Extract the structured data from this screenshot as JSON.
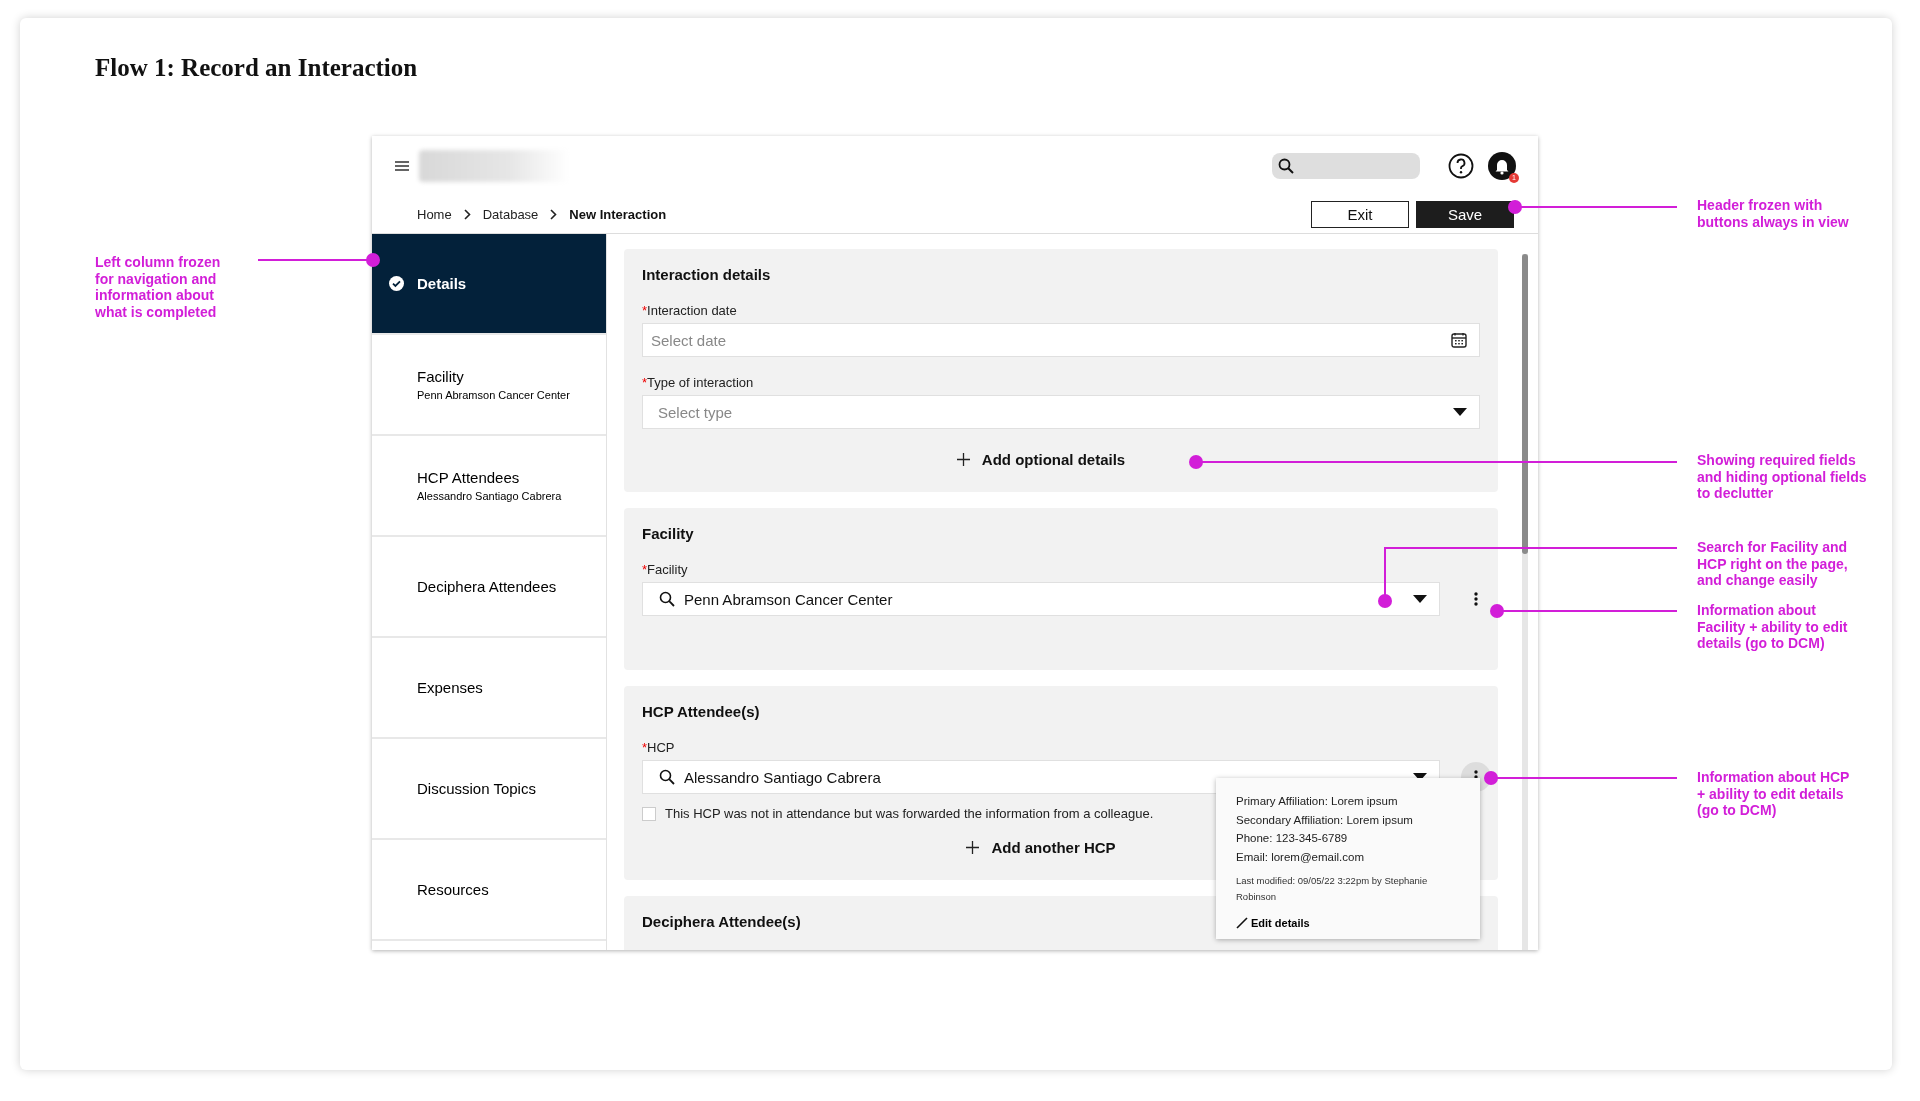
{
  "title": "Flow 1: Record an Interaction",
  "header": {
    "notification_count": "1",
    "breadcrumbs": [
      {
        "label": "Home",
        "current": false
      },
      {
        "label": "Database",
        "current": false
      },
      {
        "label": "New Interaction",
        "current": true
      }
    ],
    "buttons": [
      {
        "label": "Exit",
        "kind": "secondary"
      },
      {
        "label": "Save",
        "kind": "primary"
      }
    ]
  },
  "sidebar": {
    "items": [
      {
        "label": "Details",
        "selected": true,
        "completed": true
      },
      {
        "label": "Facility",
        "sublabel": "Penn Abramson Cancer Center",
        "selected": false,
        "completed": false
      },
      {
        "label": "HCP Attendees",
        "sublabel": "Alessandro Santiago Cabrera",
        "selected": false,
        "completed": false
      },
      {
        "label": "Deciphera Attendees",
        "selected": false,
        "completed": false
      },
      {
        "label": "Expenses",
        "selected": false,
        "completed": false
      },
      {
        "label": "Discussion Topics",
        "selected": false,
        "completed": false
      },
      {
        "label": "Resources",
        "selected": false,
        "completed": false
      }
    ]
  },
  "sections": [
    {
      "title": "Interaction details",
      "fields": [
        {
          "kind": "date",
          "required_mark": "*",
          "label": "Interaction date",
          "placeholder": "Select date"
        },
        {
          "kind": "select",
          "required_mark": "*",
          "label": "Type of interaction",
          "placeholder": "Select type"
        }
      ],
      "action": "Add optional details"
    },
    {
      "title": "Facility",
      "fields": [
        {
          "kind": "search",
          "required_mark": "*",
          "label": "Facility",
          "value": "Penn Abramson Cancer Center",
          "menu_open": false
        }
      ]
    },
    {
      "title": "HCP Attendee(s)",
      "fields": [
        {
          "kind": "search",
          "required_mark": "*",
          "label": "HCP",
          "value": "Alessandro Santiago Cabrera",
          "menu_open": true,
          "popover": {
            "lines": [
              "Primary Affiliation: Lorem ipsum",
              "Secondary Affiliation: Lorem ipsum",
              "Phone: 123-345-6789",
              "Email: lorem@email.com"
            ],
            "modified": "Last modified: 09/05/22 3:22pm by Stephanie Robinson",
            "action": "Edit details"
          }
        }
      ],
      "checkbox": {
        "label": "This HCP was not in attendance but was forwarded the information from a colleague.",
        "checked": false
      },
      "action": "Add another HCP"
    },
    {
      "title": "Deciphera Attendee(s)"
    }
  ],
  "annotations": [
    {
      "text": "Left column frozen for navigation and information about what is completed"
    },
    {
      "text": "Header frozen with buttons always in view"
    },
    {
      "text": "Showing required fields and hiding optional fields to declutter"
    },
    {
      "text": "Search for Facility and HCP right on the page, and change easily"
    },
    {
      "text": "Information about Facility + ability to edit details (go to DCM)"
    },
    {
      "text": "Information about HCP + ability to edit details (go to DCM)"
    }
  ]
}
